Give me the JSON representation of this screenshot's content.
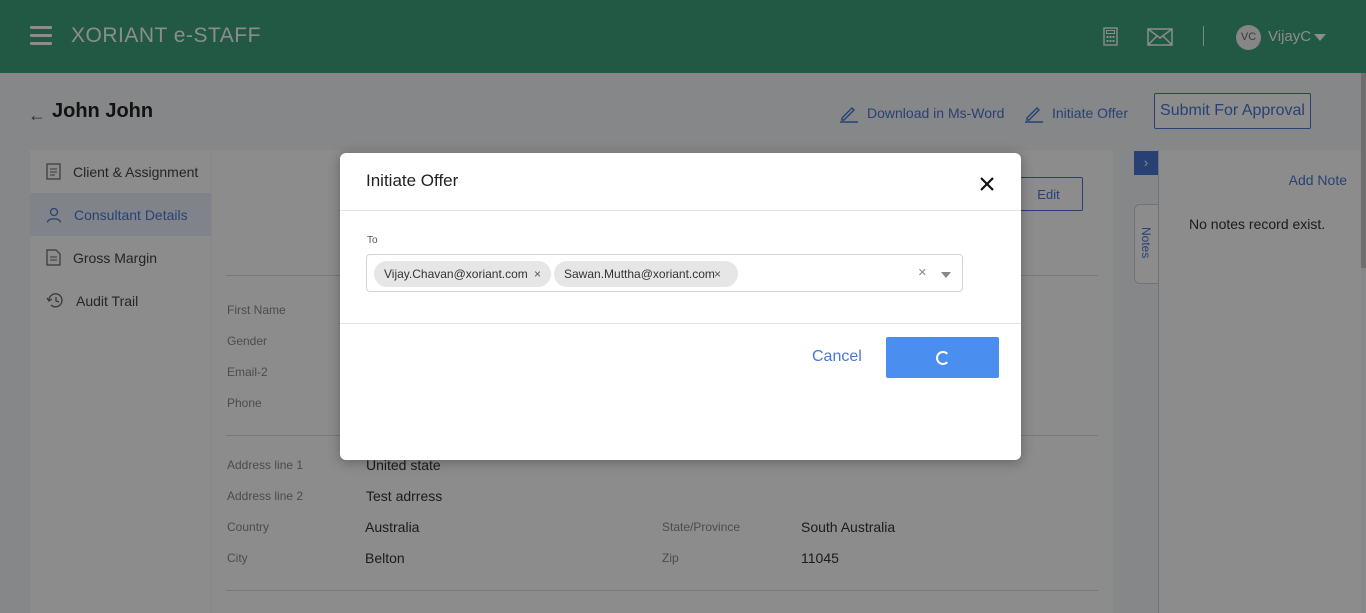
{
  "header": {
    "brand": "XORIANT e-STAFF",
    "user_initials": "VC",
    "username": "VijayC"
  },
  "page": {
    "title": "John John",
    "actions": {
      "download": "Download in Ms-Word",
      "initiate": "Initiate Offer",
      "submit": "Submit For Approval"
    }
  },
  "sidebar": {
    "items": [
      {
        "label": "Client & Assignment"
      },
      {
        "label": "Consultant Details"
      },
      {
        "label": "Gross Margin"
      },
      {
        "label": "Audit Trail"
      }
    ]
  },
  "details": {
    "edit": "Edit",
    "first_name": "First Name",
    "gender": "Gender",
    "email2": "Email-2",
    "phone": "Phone",
    "address1_label": "Address line 1",
    "address1": "United state",
    "address2_label": "Address line 2",
    "address2": "Test adrress",
    "country_label": "Country",
    "country": "Australia",
    "state_label": "State/Province",
    "state": "South Australia",
    "city_label": "City",
    "city": "Belton",
    "zip_label": "Zip",
    "zip": "11045"
  },
  "notes": {
    "tab": "Notes",
    "add": "Add Note",
    "empty": "No notes record exist."
  },
  "modal": {
    "title": "Initiate Offer",
    "to_label": "To",
    "recipients": [
      "Vijay.Chavan@xoriant.com",
      "Sawan.Muttha@xoriant.com"
    ],
    "cancel": "Cancel",
    "primary_state": "loading"
  },
  "colors": {
    "header": "#3fa27f",
    "accent": "#4a77d4",
    "primary_button": "#4a8ef0"
  }
}
